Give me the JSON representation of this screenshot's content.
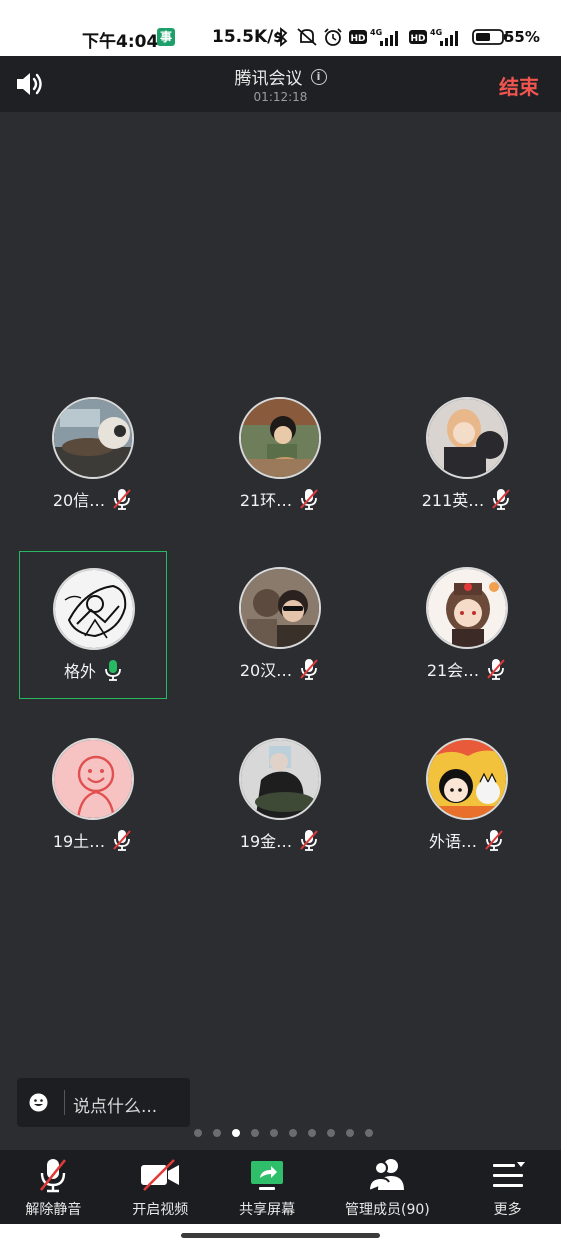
{
  "status_bar": {
    "time": "下午4:04",
    "app_badge": "事",
    "network_speed": "15.5K/s",
    "battery_percent": "55%",
    "icons": [
      "bluetooth-icon",
      "mute-icon",
      "alarm-icon",
      "hd-icon",
      "signal-4g-icon",
      "hd-icon",
      "signal-4g-icon",
      "battery-icon"
    ]
  },
  "header": {
    "title": "腾讯会议",
    "duration": "01:12:18",
    "end_label": "结束",
    "speaker_icon": "speaker-icon",
    "info_icon": "info-icon"
  },
  "colors": {
    "background": "#2b2d31",
    "end_red": "#f05550",
    "active_green": "#27b862",
    "muted_red": "#e23a3a"
  },
  "participants": [
    {
      "name": "20信…",
      "muted": true,
      "active": false
    },
    {
      "name": "21环…",
      "muted": true,
      "active": false
    },
    {
      "name": "211英…",
      "muted": true,
      "active": false
    },
    {
      "name": "格外",
      "muted": false,
      "active": true
    },
    {
      "name": "20汉…",
      "muted": true,
      "active": false
    },
    {
      "name": "21会…",
      "muted": true,
      "active": false
    },
    {
      "name": "19土…",
      "muted": true,
      "active": false
    },
    {
      "name": "19金…",
      "muted": true,
      "active": false
    },
    {
      "name": "外语…",
      "muted": true,
      "active": false
    }
  ],
  "chat": {
    "placeholder": "说点什么..."
  },
  "pagination": {
    "total_pages": 10,
    "current_page": 3
  },
  "toolbar": {
    "unmute_label": "解除静音",
    "video_label": "开启视频",
    "share_label": "共享屏幕",
    "members_label": "管理成员(90)",
    "more_label": "更多"
  }
}
